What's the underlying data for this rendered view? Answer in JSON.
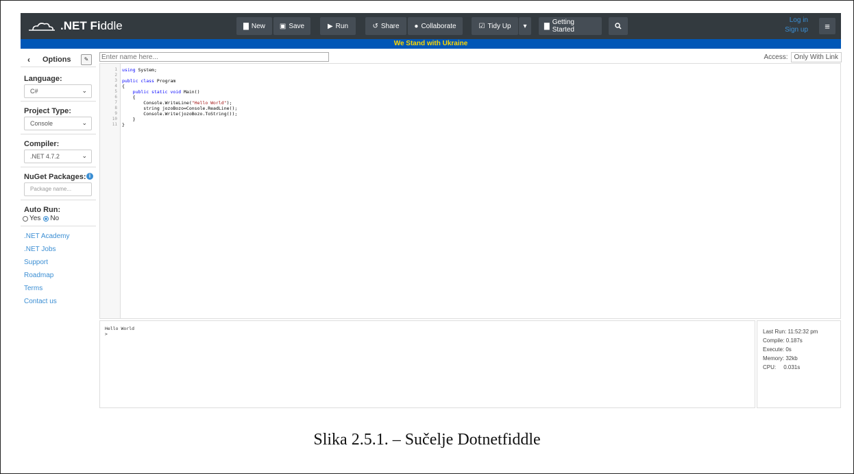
{
  "app": {
    "logo_text_bold": ".NET Fi",
    "logo_text_light": "ddle"
  },
  "toolbar": {
    "new_label": "New",
    "save_label": "Save",
    "run_label": "Run",
    "share_label": "Share",
    "collaborate_label": "Collaborate",
    "tidy_label": "Tidy Up",
    "getting_started_label": "Getting Started",
    "login_label": "Log in",
    "signup_label": "Sign up"
  },
  "banner": {
    "text": "We Stand with Ukraine"
  },
  "sidebar": {
    "title": "Options",
    "language_label": "Language:",
    "language_value": "C#",
    "project_label": "Project Type:",
    "project_value": "Console",
    "compiler_label": "Compiler:",
    "compiler_value": ".NET 4.7.2",
    "nuget_label": "NuGet Packages:",
    "nuget_placeholder": "Package name...",
    "autorun_label": "Auto Run:",
    "autorun_yes": "Yes",
    "autorun_no": "No",
    "links": [
      ".NET Academy",
      ".NET Jobs",
      "Support",
      "Roadmap",
      "Terms",
      "Contact us"
    ]
  },
  "editor": {
    "name_placeholder": "Enter name here...",
    "access_label": "Access:",
    "access_value": "Only With Link",
    "line_numbers": [
      "1",
      "2",
      "3",
      "4",
      "5",
      "6",
      "7",
      "8",
      "9",
      "10",
      "11"
    ]
  },
  "output": {
    "line1": "Hello World",
    "line2": ">"
  },
  "stats": {
    "last_run": "Last Run: 11:52:32 pm",
    "compile": "Compile:  0.187s",
    "execute": "Execute:  0s",
    "memory": "Memory:  32kb",
    "cpu": "CPU:     0.031s"
  },
  "caption": {
    "text": "Slika 2.5.1. – Sučelje Dotnetfiddle"
  },
  "colors": {
    "topbar": "#333a3f",
    "banner_bg": "#0057b7",
    "banner_text": "#ffd700",
    "link": "#3b8ed3"
  }
}
